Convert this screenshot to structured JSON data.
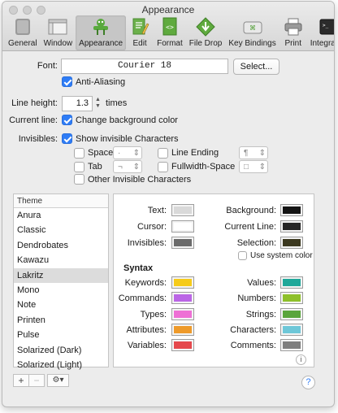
{
  "window": {
    "title": "Appearance"
  },
  "toolbar": {
    "items": [
      {
        "label": "General",
        "icon": "general-pref-icon"
      },
      {
        "label": "Window",
        "icon": "window-pref-icon"
      },
      {
        "label": "Appearance",
        "icon": "appearance-pref-icon",
        "active": true
      },
      {
        "label": "Edit",
        "icon": "edit-pref-icon"
      },
      {
        "label": "Format",
        "icon": "format-pref-icon"
      },
      {
        "label": "File Drop",
        "icon": "file-drop-pref-icon"
      },
      {
        "label": "Key Bindings",
        "icon": "key-bindings-pref-icon"
      },
      {
        "label": "Print",
        "icon": "print-pref-icon"
      },
      {
        "label": "Integration",
        "icon": "integration-pref-icon"
      }
    ]
  },
  "font": {
    "label": "Font:",
    "value": "Courier 18",
    "select_button": "Select...",
    "antialias_label": "Anti-Aliasing",
    "antialias_checked": true
  },
  "line_height": {
    "label": "Line height:",
    "value": "1.3",
    "unit": "times"
  },
  "current_line": {
    "label": "Current line:",
    "checkbox_label": "Change background color",
    "checked": true
  },
  "invisibles": {
    "label": "Invisibles:",
    "show_label": "Show invisible Characters",
    "show_checked": true,
    "space": {
      "label": "Space",
      "char": "·"
    },
    "tab": {
      "label": "Tab",
      "char": "¬"
    },
    "line_ending": {
      "label": "Line Ending",
      "char": "¶"
    },
    "fullwidth_space": {
      "label": "Fullwidth-Space",
      "char": "□"
    },
    "other_label": "Other Invisible Characters"
  },
  "themes": {
    "header": "Theme",
    "items": [
      "Anura",
      "Classic",
      "Dendrobates",
      "Kawazu",
      "Lakritz",
      "Mono",
      "Note",
      "Printen",
      "Pulse",
      "Solarized (Dark)",
      "Solarized (Light)"
    ],
    "selected_index": 4,
    "add_label": "+",
    "remove_label": "−"
  },
  "colors": {
    "text": {
      "label": "Text:",
      "color": "#d9d9d9"
    },
    "cursor": {
      "label": "Cursor:",
      "color": "#ffffff"
    },
    "invisibles": {
      "label": "Invisibles:",
      "color": "#6b6b6b"
    },
    "background": {
      "label": "Background:",
      "color": "#141414"
    },
    "current_line": {
      "label": "Current Line:",
      "color": "#262626"
    },
    "selection": {
      "label": "Selection:",
      "color": "#3c3920"
    },
    "use_system_color": "Use system color",
    "syntax_heading": "Syntax",
    "keywords": {
      "label": "Keywords:",
      "color": "#f6cb1a"
    },
    "commands": {
      "label": "Commands:",
      "color": "#bb66e6"
    },
    "types": {
      "label": "Types:",
      "color": "#ee70d5"
    },
    "attributes": {
      "label": "Attributes:",
      "color": "#ee9a2a"
    },
    "variables": {
      "label": "Variables:",
      "color": "#e5484c"
    },
    "values": {
      "label": "Values:",
      "color": "#20a89a"
    },
    "numbers": {
      "label": "Numbers:",
      "color": "#8ec02a"
    },
    "strings": {
      "label": "Strings:",
      "color": "#5aa53c"
    },
    "characters": {
      "label": "Characters:",
      "color": "#6ec7d8"
    },
    "comments": {
      "label": "Comments:",
      "color": "#7e7e7e"
    }
  }
}
